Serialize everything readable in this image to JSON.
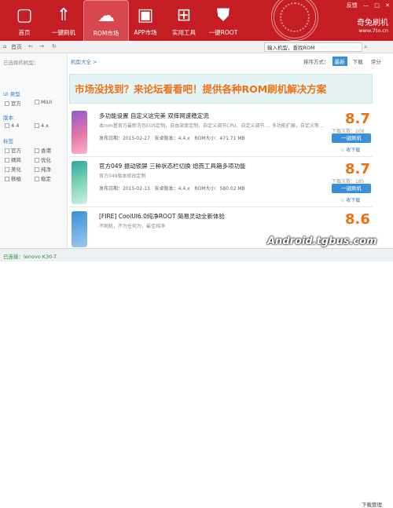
{
  "nav": [
    {
      "label": "首页",
      "icon": "home-icon",
      "glyph": "▢"
    },
    {
      "label": "一键刷机",
      "icon": "rocket-icon",
      "glyph": "⇑"
    },
    {
      "label": "ROM市场",
      "icon": "cloud-icon",
      "glyph": "☁"
    },
    {
      "label": "APP市场",
      "icon": "app-bag-icon",
      "glyph": "▣"
    },
    {
      "label": "实用工具",
      "icon": "windows-grid-icon",
      "glyph": "⊞"
    },
    {
      "label": "一键ROOT",
      "icon": "shield-icon",
      "glyph": "⛊"
    }
  ],
  "window": {
    "feedback": "反馈",
    "minimize": "—",
    "maximize": "□",
    "close": "✕"
  },
  "brand": {
    "name": "奇兔刷机",
    "url": "www.7to.cn"
  },
  "toolbar": {
    "home": "首页",
    "search_placeholder": "输入机型，查找ROM"
  },
  "sidebar": {
    "title": "已选择的机型：",
    "groups": [
      {
        "title": "UI 类型",
        "items": [
          "官方",
          "MIUI"
        ]
      },
      {
        "title": "版本",
        "items": [
          "4.4",
          "4.x"
        ]
      },
      {
        "title": "标签",
        "items": [
          "官方",
          "香港",
          "精简",
          "优化",
          "美化",
          "纯净",
          "移植",
          "稳定"
        ]
      }
    ]
  },
  "main": {
    "breadcrumb": "机型大全 >",
    "sort_label": "排序方式：",
    "sort_options": [
      "最新",
      "下载",
      "评分"
    ],
    "banner": "市场没找到？来论坛看看吧！提供各种ROM刷机解决方案"
  },
  "roms": [
    {
      "title": "多功能设置 自定义这完美 双摔网速稳定流",
      "desc": "本rom基官方最新洗包EOS定制，自由深度定制，自定义调节CPU，自定义调节 ... 多功能扩展，自定义等...",
      "date": "发布日期：2015-02-27",
      "android": "安卓版本：4.4.x",
      "size": "ROM大小：471.71 MB",
      "score": "8.7",
      "downloads": "下载次数：208",
      "flash": "一键刷机",
      "fav": "☆ 收下载"
    },
    {
      "title": "官方049 振动锁屏 三种状态栏切换 熄而工具箱多项功能",
      "desc": "官方049版本修改定制",
      "date": "发布日期：2015-02-13",
      "android": "安卓版本：4.4.x",
      "size": "ROM大小：580.02 MB",
      "score": "8.7",
      "downloads": "下载次数：185",
      "flash": "一键刷机",
      "fav": "☆ 收下载"
    },
    {
      "title": "[FIRE] CoolUI6.0纯净ROOT 简易灵动全新体验",
      "desc": "不刷机，不为任何为，最佳纯净",
      "date": "",
      "android": "",
      "size": "",
      "score": "8.6",
      "downloads": "",
      "flash": "",
      "fav": ""
    }
  ],
  "status": {
    "connected": "已连接：lenovo K30-T",
    "download_manager": "下载管理"
  },
  "watermark": "Android.tgbus.com"
}
